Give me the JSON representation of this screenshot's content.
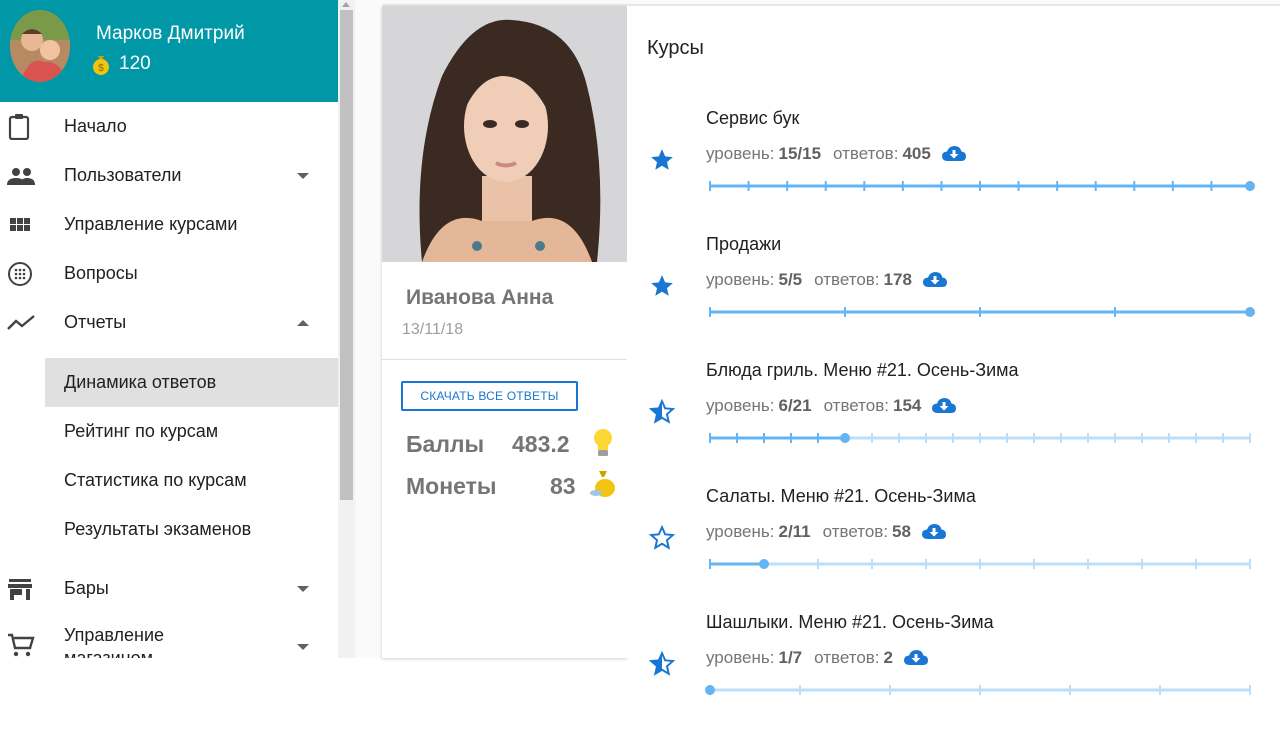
{
  "user": {
    "name": "Марков Дмитрий",
    "coins": "120"
  },
  "nav": [
    {
      "label": "Начало",
      "icon": "clipboard-icon"
    },
    {
      "label": "Пользователи",
      "icon": "people-icon"
    },
    {
      "label": "Управление курсами",
      "icon": "grid-icon"
    },
    {
      "label": "Вопросы",
      "icon": "dots-circle-icon"
    },
    {
      "label": "Отчеты",
      "icon": "trending-icon"
    },
    {
      "label": "Бары",
      "icon": "store-icon"
    },
    {
      "label": "Управление магазином",
      "icon": "cart-icon"
    }
  ],
  "reports_submenu": [
    {
      "label": "Динамика ответов",
      "active": true
    },
    {
      "label": "Рейтинг по курсам"
    },
    {
      "label": "Статистика по курсам"
    },
    {
      "label": "Результаты экзаменов"
    }
  ],
  "profile": {
    "name": "Иванова Анна",
    "date": "13/11/18",
    "download_all": "СКАЧАТЬ ВСЕ ОТВЕТЫ",
    "points_label": "Баллы",
    "points_value": "483.2",
    "coins_label": "Монеты",
    "coins_value": "83"
  },
  "courses": {
    "title": "Курсы",
    "level_label": "уровень:",
    "answers_label": "ответов:",
    "items": [
      {
        "title": "Сервис бук",
        "level": "15/15",
        "answers": "405",
        "level_current": 15,
        "level_max": 15,
        "star": "full"
      },
      {
        "title": "Продажи",
        "level": "5/5",
        "answers": "178",
        "level_current": 5,
        "level_max": 5,
        "star": "full"
      },
      {
        "title": "Блюда гриль. Меню #21. Осень-Зима",
        "level": "6/21",
        "answers": "154",
        "level_current": 6,
        "level_max": 21,
        "star": "half"
      },
      {
        "title": "Салаты. Меню #21. Осень-Зима",
        "level": "2/11",
        "answers": "58",
        "level_current": 2,
        "level_max": 11,
        "star": "empty"
      },
      {
        "title": "Шашлыки. Меню #21. Осень-Зима",
        "level": "1/7",
        "answers": "2",
        "level_current": 1,
        "level_max": 7,
        "star": "half"
      }
    ]
  },
  "colors": {
    "header": "#0097a7",
    "accent": "#1976d2",
    "slider": "#64b5f6",
    "slider_track": "#bbdefb"
  }
}
